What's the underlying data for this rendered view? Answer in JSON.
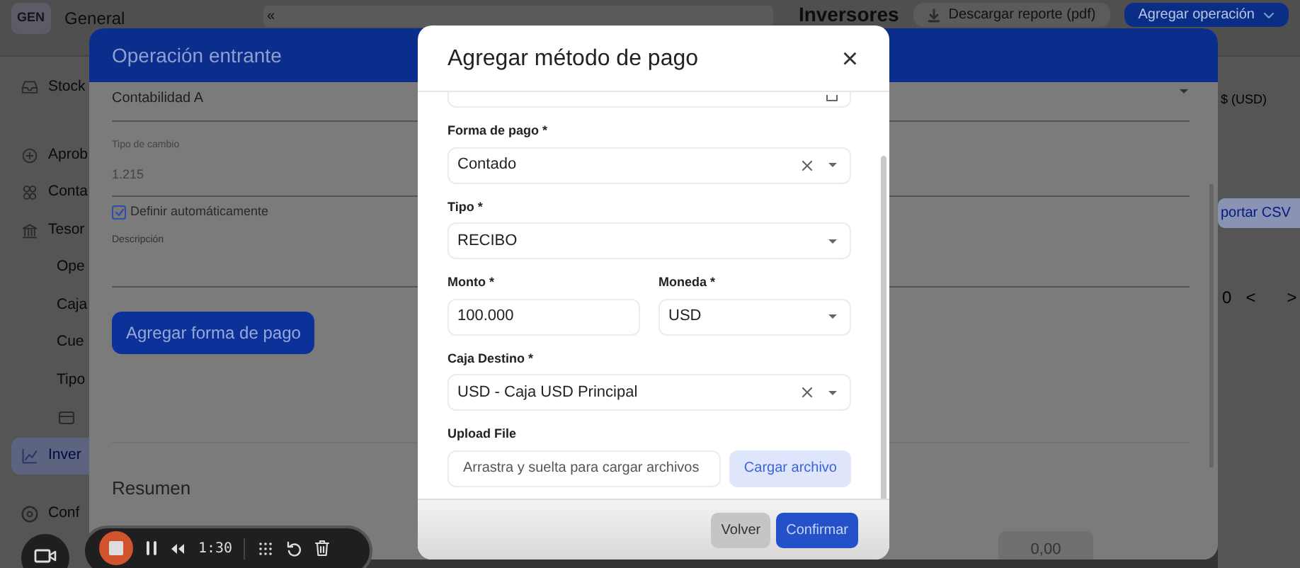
{
  "app": {
    "workspace_badge": "GEN",
    "workspace": "General",
    "collapse_glyph": "«",
    "page_title": "Inversores",
    "header_buttons": [
      {
        "label": "Descargar reporte (pdf)",
        "kind": "download"
      },
      {
        "label": "Agregar operación",
        "kind": "primary"
      }
    ],
    "sidebar": [
      {
        "label": "Stock",
        "kind": "main",
        "selected": false
      },
      {
        "label": "Aprob",
        "kind": "main",
        "selected": false
      },
      {
        "label": "Conta",
        "kind": "main",
        "selected": false
      },
      {
        "label": "Tesor",
        "kind": "main",
        "selected": false
      },
      {
        "label": "Ope",
        "kind": "sub",
        "selected": false
      },
      {
        "label": "Caja",
        "kind": "sub",
        "selected": false
      },
      {
        "label": "Cue",
        "kind": "sub",
        "selected": false
      },
      {
        "label": "Tipo",
        "kind": "sub",
        "selected": false
      },
      {
        "kind": "sub-icon",
        "selected": false
      },
      {
        "label": "Inver",
        "kind": "main",
        "selected": true
      },
      {
        "label": "Conf",
        "kind": "main",
        "selected": false
      }
    ],
    "right_panel": {
      "currency_label": "$ (USD)",
      "export_button": "portar CSV",
      "pager_text": "0",
      "prev": "<",
      "next": ">"
    },
    "footer_value": "0,00"
  },
  "operation_modal": {
    "title": "Operación entrante",
    "accounting_value": "Contabilidad A",
    "rate_label": "Tipo de cambio",
    "rate_value": "1.215",
    "auto_checkbox": {
      "label": "Definir automáticamente",
      "checked": true
    },
    "description_label": "Descripción",
    "add_button": "Agregar forma de pago",
    "summary_title": "Resumen"
  },
  "payment_modal": {
    "title": "Agregar método de pago",
    "close": "×",
    "fields": [
      {
        "kind": "date"
      },
      {
        "kind": "select",
        "label": "Forma de pago *",
        "value": "Contado",
        "clearable": true
      },
      {
        "kind": "select",
        "label": "Tipo *",
        "value": "RECIBO",
        "clearable": false
      },
      {
        "kind": "pair",
        "fields": [
          {
            "kind": "input",
            "label": "Monto *",
            "value": "100.000"
          },
          {
            "kind": "select",
            "label": "Moneda *",
            "value": "USD",
            "clearable": false
          }
        ]
      },
      {
        "kind": "select",
        "label": "Caja Destino *",
        "value": "USD - Caja USD Principal",
        "clearable": true
      },
      {
        "kind": "upload",
        "label": "Upload File",
        "placeholder": "Arrastra y suelta para cargar archivos",
        "button": "Cargar archivo"
      }
    ],
    "buttons": [
      {
        "label": "Volver",
        "kind": "secondary"
      },
      {
        "label": "Confirmar",
        "kind": "primary"
      }
    ]
  },
  "recorder": {
    "time": "1:30"
  }
}
